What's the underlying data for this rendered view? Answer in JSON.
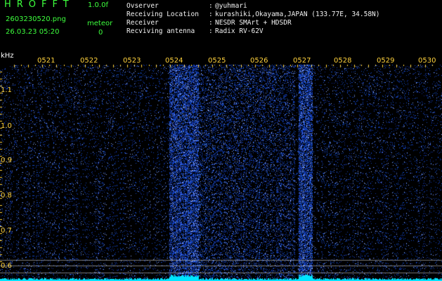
{
  "app": {
    "name": "HROFFT",
    "version": "1.0.0f"
  },
  "left_panel": {
    "filename": "2603230520.png",
    "datetime": "26.03.23 05:20",
    "mode": "meteor",
    "count": "0"
  },
  "info": {
    "rows": [
      {
        "key": "Ovserver",
        "value": "@yuhmari"
      },
      {
        "key": "Receiving Location",
        "value": "kurashiki,Okayama,JAPAN (133.77E, 34.58N)"
      },
      {
        "key": "Receiver",
        "value": "NESDR SMArt + HDSDR"
      },
      {
        "key": "Recviving antenna",
        "value": "Radix RV-62V"
      }
    ],
    "colon": ":"
  },
  "axis": {
    "unit": "kHz",
    "time_labels": [
      "0521",
      "0522",
      "0523",
      "0524",
      "0525",
      "0526",
      "0527",
      "0528",
      "0529",
      "0530"
    ],
    "freq_labels": [
      "1.1",
      "1.0",
      "0.9",
      "0.8",
      "0.7",
      "0.6"
    ]
  },
  "colors": {
    "background": "#000000",
    "noise": "#1020c8",
    "signal": "#5a8cff",
    "trace": "#00e5ff",
    "label": "#ffd23d",
    "title": "#3dff3d"
  }
}
